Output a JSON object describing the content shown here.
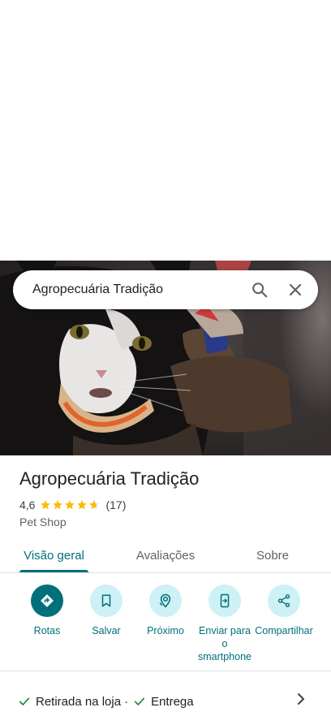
{
  "search": {
    "query": "Agropecuária Tradição"
  },
  "place": {
    "name": "Agropecuária Tradição",
    "rating": "4,6",
    "rating_value": 4.6,
    "reviews_count": "(17)",
    "category": "Pet Shop"
  },
  "tabs": [
    {
      "label": "Visão geral",
      "active": true
    },
    {
      "label": "Avaliações",
      "active": false
    },
    {
      "label": "Sobre",
      "active": false
    }
  ],
  "actions": [
    {
      "label": "Rotas",
      "icon": "directions-icon"
    },
    {
      "label": "Salvar",
      "icon": "bookmark-icon"
    },
    {
      "label": "Próximo",
      "icon": "nearby-icon"
    },
    {
      "label": "Enviar para o smartphone",
      "icon": "send-to-phone-icon"
    },
    {
      "label": "Compartilhar",
      "icon": "share-icon"
    }
  ],
  "services": {
    "item1": "Retirada na loja",
    "separator": "·",
    "item2": "Entrega"
  },
  "colors": {
    "accent": "#00707a",
    "accent_light": "#cdf1f4",
    "star": "#fbbc04",
    "check": "#188038"
  }
}
